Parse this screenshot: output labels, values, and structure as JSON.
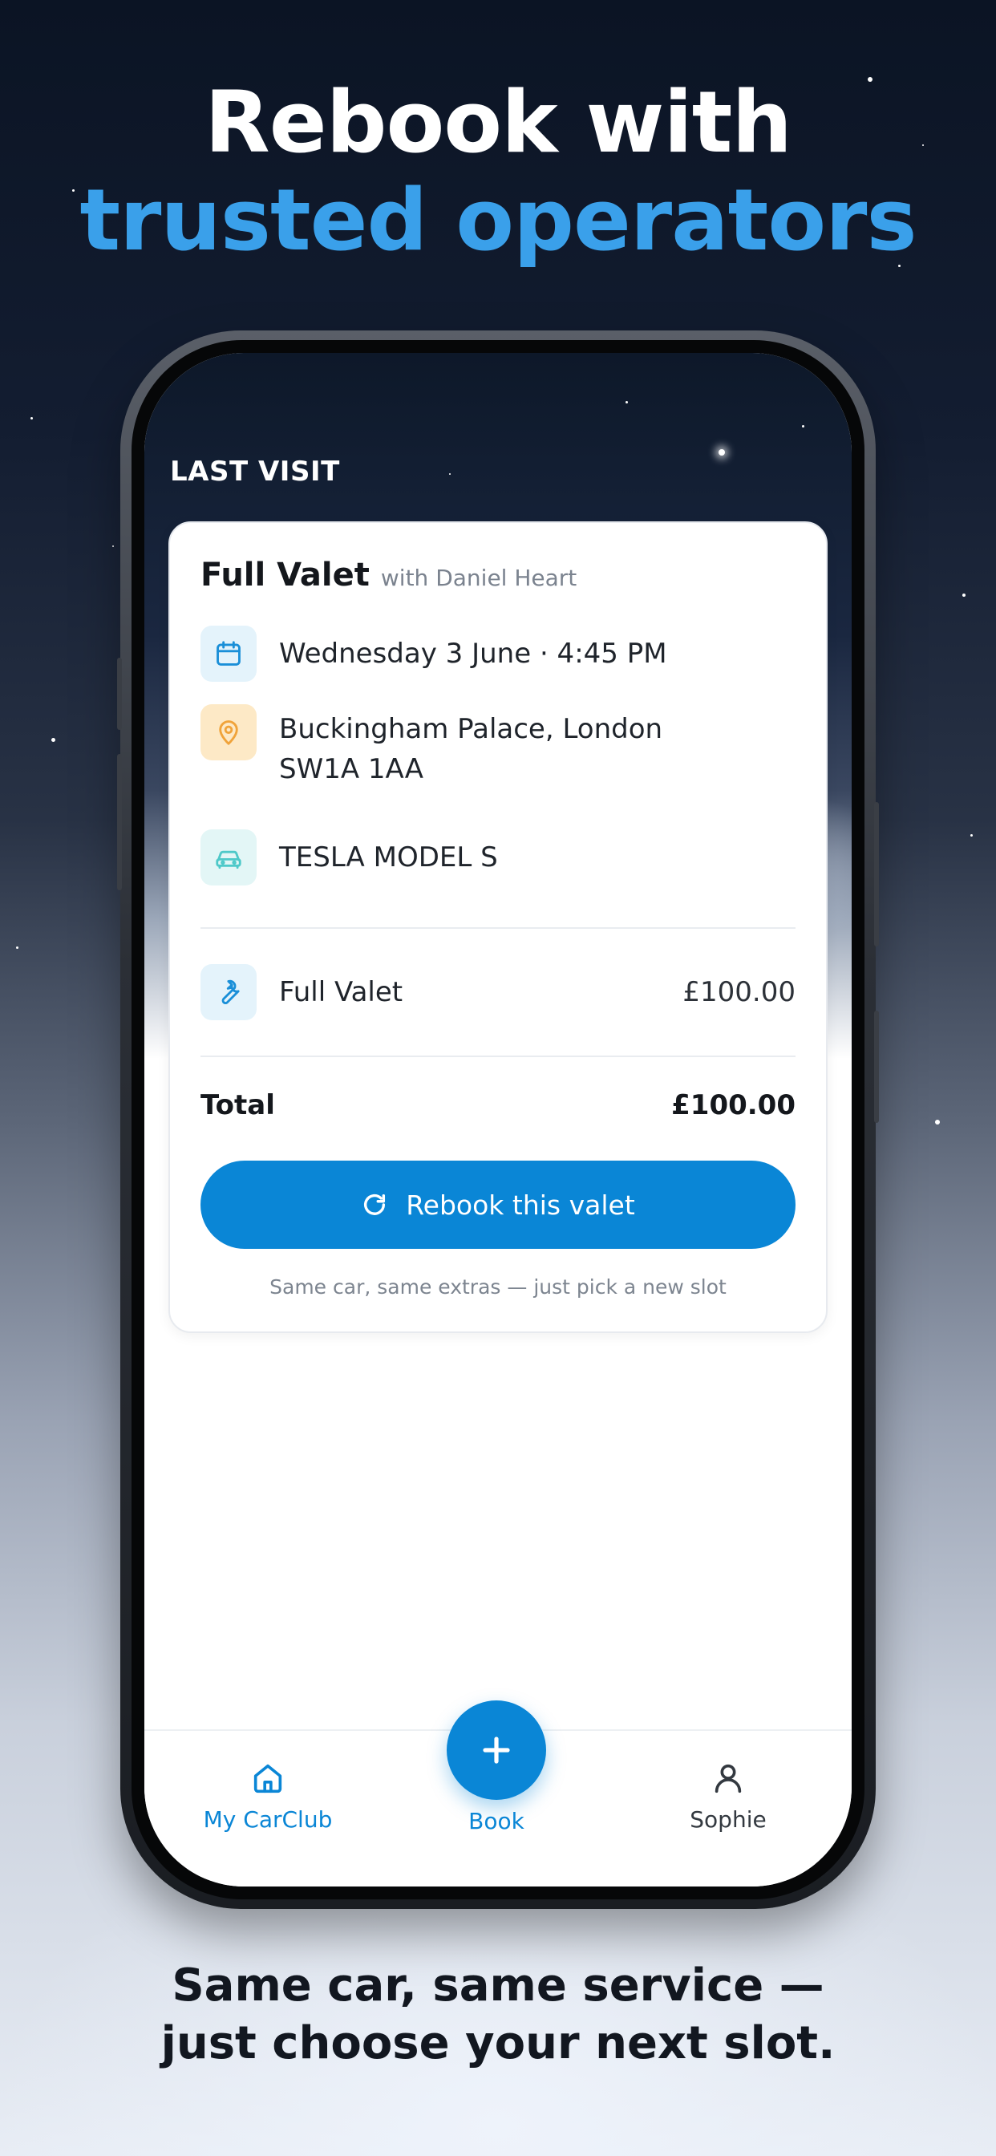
{
  "headline": {
    "line1": "Rebook with",
    "line2": "trusted operators"
  },
  "section_label": "LAST VISIT",
  "visit_card": {
    "service_title": "Full Valet",
    "operator": "with Daniel Heart",
    "datetime": "Wednesday 3 June · 4:45 PM",
    "address_line1": "Buckingham Palace, London",
    "address_line2": "SW1A 1AA",
    "vehicle": "TESLA MODEL S",
    "line_item": {
      "name": "Full Valet",
      "price": "£100.00"
    },
    "total_label": "Total",
    "total_value": "£100.00",
    "rebook_label": "Rebook this valet",
    "hint": "Same car, same extras — just pick a new slot",
    "icons": [
      "calendar-icon",
      "location-pin-icon",
      "car-icon",
      "wrench-icon",
      "refresh-icon"
    ]
  },
  "tabbar": {
    "home_label": "My CarClub",
    "book_label": "Book",
    "profile_label": "Sophie",
    "icons": [
      "home-icon",
      "plus-icon",
      "user-icon"
    ]
  },
  "caption": {
    "line1": "Same car, same service —",
    "line2": "just choose your next slot."
  },
  "colors": {
    "accent": "#0A86D6",
    "headline_blue": "#3AA0EA",
    "pin_orange": "#F0A33A",
    "car_teal": "#4FC9C9"
  }
}
